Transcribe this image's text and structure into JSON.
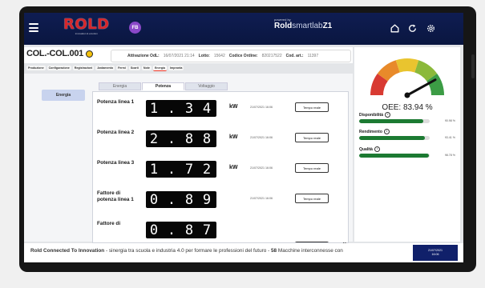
{
  "header": {
    "brand": "ROLD",
    "tagline": "innovation & emotion",
    "avatar_initials": "FB",
    "powered_by": "powered by",
    "product_bold": "Rold",
    "product_light": "smartlab",
    "product_suffix": "Z1"
  },
  "machine": {
    "code": "COL.-COL.001",
    "status_color": "#f4c20d",
    "attivazione_label": "Attivazione OdL:",
    "attivazione_value": "16/07/2021 21:14",
    "lotto_label": "Lotto:",
    "lotto_value": "15642",
    "codice_label": "Codice Ordine:",
    "codice_value": "820217522",
    "cod_art_label": "Cod. art.:",
    "cod_art_value": "11397"
  },
  "tabs": [
    "Produzione",
    "Configurazione",
    "Registrazioni",
    "Andamento",
    "Fermi",
    "Scarti",
    "Note",
    "Energia",
    "Impronta"
  ],
  "active_tab": "Energia",
  "sidebar": {
    "item": "Energia"
  },
  "subtabs": [
    "Energia",
    "Potenza",
    "Voltaggio"
  ],
  "active_subtab": "Potenza",
  "rows": [
    {
      "label": "Potenza linea 1",
      "digits": [
        "1",
        ".",
        "3",
        "4"
      ],
      "unit": "kW",
      "timestamp": "21/07/2021 16:06",
      "button": "Tempo reale"
    },
    {
      "label": "Potenza linea 2",
      "digits": [
        "2",
        ".",
        "8",
        "8"
      ],
      "unit": "kW",
      "timestamp": "21/07/2021 16:06",
      "button": "Tempo reale"
    },
    {
      "label": "Potenza linea 3",
      "digits": [
        "1",
        ".",
        "7",
        "2"
      ],
      "unit": "kW",
      "timestamp": "21/07/2021 16:06",
      "button": "Tempo reale"
    },
    {
      "label": "Fattore di potenza linea 1",
      "digits": [
        "0",
        ".",
        "8",
        "9"
      ],
      "unit": "",
      "timestamp": "21/07/2021 16:06",
      "button": "Tempo reale"
    },
    {
      "label": "Fattore di",
      "digits": [
        "0",
        ".",
        "8",
        "7"
      ],
      "unit": "",
      "timestamp": "",
      "button": ""
    }
  ],
  "oee": {
    "title": "OEE: 83.94 %",
    "gauge_value": 0.8394,
    "gauge_colors": [
      "#d83a32",
      "#e88a2a",
      "#e9c42f",
      "#8bb93a",
      "#3c9c45"
    ],
    "metrics": [
      {
        "name": "Disponibilità",
        "value": "90.98 %",
        "fraction": 0.9098
      },
      {
        "name": "Rendimento",
        "value": "93.41 %",
        "fraction": 0.9341
      },
      {
        "name": "Qualità",
        "value": "98.78 %",
        "fraction": 0.9878
      }
    ]
  },
  "footer": {
    "bold": "Rold Connected To Innovation",
    "text": " - sinergia tra scuola e industria 4.0 per formare le professioni del futuro - ",
    "count": "58",
    "text2": " Macchine interconnesse con",
    "date": "21/07/2021",
    "time": "16:06"
  }
}
